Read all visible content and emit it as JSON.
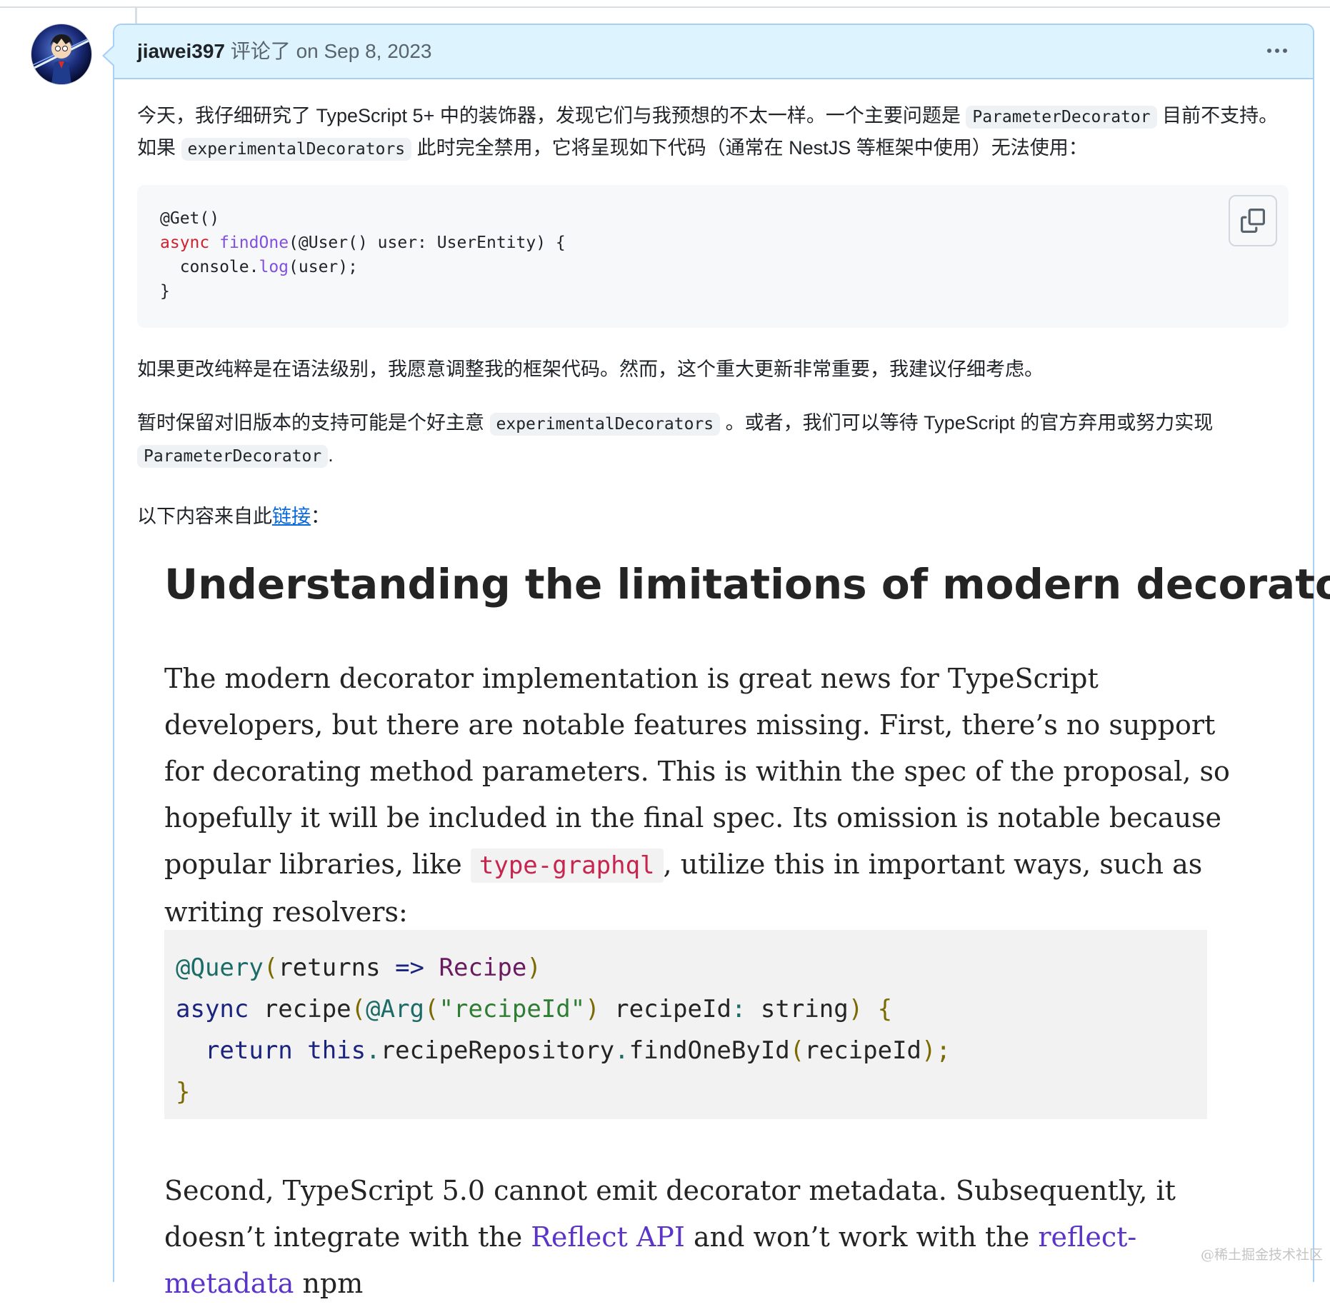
{
  "comment": {
    "author": "jiawei397",
    "action": "评论了",
    "date": "on Sep 8, 2023",
    "more_icon": "kebab-horizontal-icon",
    "avatar_icon": "anime-avatar"
  },
  "body": {
    "p1_a": "今天，我仔细研究了 TypeScript 5+ 中的装饰器，发现它们与我预想的不太一样。一个主要问题是",
    "p1_code1": "ParameterDecorator",
    "p1_b": "目前不支持。如果",
    "p1_code2": "experimentalDecorators",
    "p1_c": "此时完全禁用，它将呈现如下代码（通常在 NestJS 等框架中使用）无法使用：",
    "code": {
      "line1": "@Get()",
      "line2_kw": "async",
      "line2_fn": "findOne",
      "line2_rest": "(@User() user: UserEntity) {",
      "line3_a": "  console.",
      "line3_fn": "log",
      "line3_b": "(user);",
      "line4": "}",
      "copy_icon": "copy-icon"
    },
    "p2": "如果更改纯粹是在语法级别，我愿意调整我的框架代码。然而，这个重大更新非常重要，我建议仔细考虑。",
    "p3_a": "暂时保留对旧版本的支持可能是个好主意",
    "p3_code1": "experimentalDecorators",
    "p3_b": "。或者，我们可以等待 TypeScript 的官方弃用或努力实现",
    "p3_code2": "ParameterDecorator",
    "p3_c": ".",
    "p4_a": "以下内容来自此",
    "p4_link": "链接",
    "p4_b": "："
  },
  "quote": {
    "heading": "Understanding the limitations of modern decorators",
    "para1_a": "The modern decorator implementation is great news for TypeScript developers, but there are notable features missing. First, there’s no support for decorating method parameters. This is within the spec of the proposal, so hopefully it will be included in the final spec. Its omission is notable because popular libraries, like",
    "para1_code": "type-graphql",
    "para1_b": ", utilize this in important ways, such as writing resolvers:",
    "code": {
      "l1_dec": "@Query",
      "l1_p1": "(",
      "l1_a": "returns ",
      "l1_arrow": "=>",
      "l1_type": " Recipe",
      "l1_p2": ")",
      "l2_kw": "async",
      "l2_a": " recipe",
      "l2_p1": "(",
      "l2_dec": "@Arg",
      "l2_p2": "(",
      "l2_str": "\"recipeId\"",
      "l2_p3": ")",
      "l2_b": " recipeId",
      "l2_colon": ":",
      "l2_c": " string",
      "l2_p4": ")",
      "l2_brace": " {",
      "l3_kw1": "  return",
      "l3_kw2": " this",
      "l3_dot1": ".",
      "l3_a": "recipeRepository",
      "l3_dot2": ".",
      "l3_b": "findOneById",
      "l3_p1": "(",
      "l3_c": "recipeId",
      "l3_p2": ")",
      "l3_semi": ";",
      "l4": "}"
    },
    "para2_a": "Second, TypeScript 5.0 cannot emit decorator metadata. Subsequently, it doesn’t integrate with the",
    "para2_link1": "Reflect API",
    "para2_b": "and won’t work with the",
    "para2_link2": "reflect-metadata",
    "para2_c": "npm"
  },
  "watermark": "@稀土掘金技术社区",
  "colors": {
    "header_bg": "#ddf4ff",
    "header_border": "#a8d0f5",
    "link_blue": "#0969da",
    "link_purple": "#5b34c8",
    "code_keyword": "#cf222e",
    "code_function": "#8250df"
  }
}
